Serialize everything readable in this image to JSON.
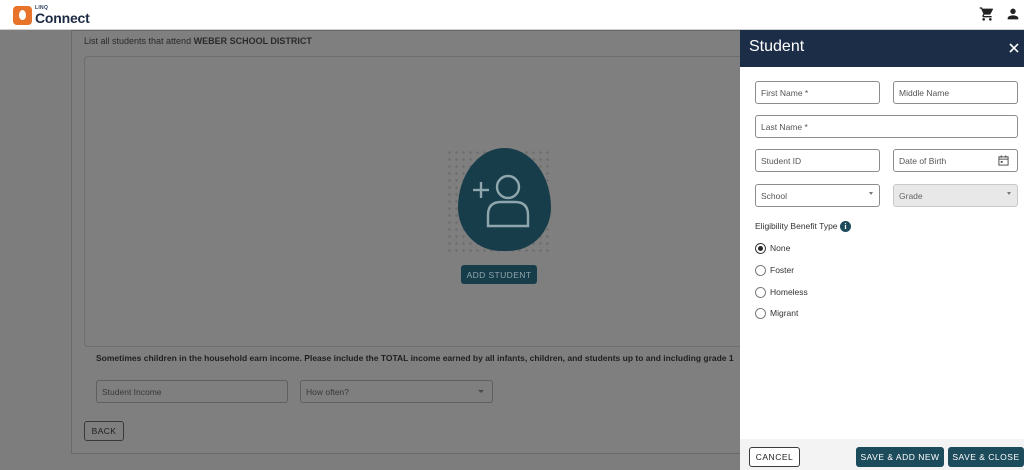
{
  "app": {
    "logo_small": "LINQ",
    "logo_name": "Connect",
    "icons": {
      "cart": "shopping-cart-icon",
      "account": "account-icon"
    }
  },
  "background": {
    "list_prefix": "List all students that attend ",
    "district": "WEBER SCHOOL DISTRICT",
    "add_student_label": "ADD STUDENT",
    "income_note": "Sometimes children in the household earn income. Please include the TOTAL income earned by all infants, children, and students up to and including grade 1",
    "student_income_placeholder": "Student Income",
    "how_often_placeholder": "How often?",
    "back_label": "BACK"
  },
  "drawer": {
    "title": "Student",
    "fields": {
      "first_name": "First Name *",
      "middle_name": "Middle Name",
      "last_name": "Last Name *",
      "student_id": "Student ID",
      "date_of_birth": "Date of Birth",
      "school": "School",
      "grade": "Grade"
    },
    "eligibility_label": "Eligibility Benefit Type",
    "eligibility_options": [
      {
        "label": "None",
        "checked": true
      },
      {
        "label": "Foster",
        "checked": false
      },
      {
        "label": "Homeless",
        "checked": false
      },
      {
        "label": "Migrant",
        "checked": false
      }
    ],
    "buttons": {
      "cancel": "CANCEL",
      "save_add_new": "SAVE & ADD NEW",
      "save_close": "SAVE & CLOSE"
    }
  },
  "colors": {
    "header_navy": "#1c2d48",
    "teal": "#1c4b5c",
    "overlay_gray": "#7f7f7f",
    "logo_orange": "#e8732a"
  }
}
